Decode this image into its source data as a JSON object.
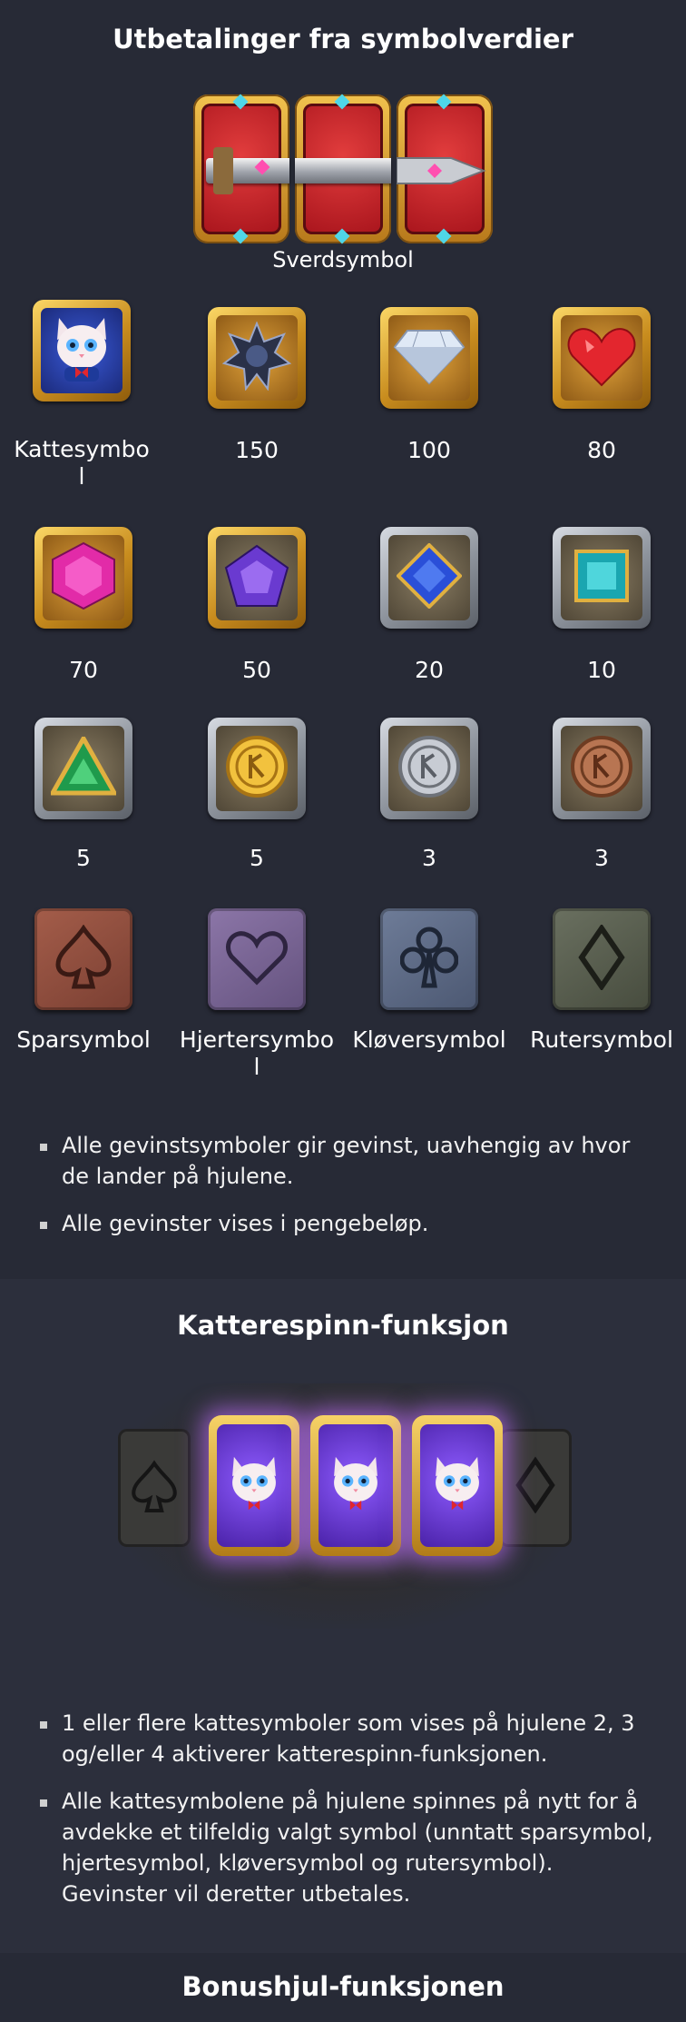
{
  "payouts": {
    "title": "Utbetalinger fra symbolverdier",
    "sword_label": "Sverdsymbol",
    "rows": [
      [
        {
          "icon": "cat-icon",
          "label_line1": "Kattesymbo",
          "label_line2": "l"
        },
        {
          "icon": "black-star-gem-icon",
          "label_line1": "150",
          "label_line2": ""
        },
        {
          "icon": "diamond-icon",
          "label_line1": "100",
          "label_line2": ""
        },
        {
          "icon": "red-heart-gem-icon",
          "label_line1": "80",
          "label_line2": ""
        }
      ],
      [
        {
          "icon": "pink-hexagon-gem-icon",
          "label_line1": "70",
          "label_line2": ""
        },
        {
          "icon": "purple-pentagon-gem-icon",
          "label_line1": "50",
          "label_line2": ""
        },
        {
          "icon": "blue-square-gem-icon",
          "label_line1": "20",
          "label_line2": ""
        },
        {
          "icon": "teal-rectangle-gem-icon",
          "label_line1": "10",
          "label_line2": ""
        }
      ],
      [
        {
          "icon": "green-triangle-gem-icon",
          "label_line1": "5",
          "label_line2": ""
        },
        {
          "icon": "gold-coin-icon",
          "label_line1": "5",
          "label_line2": ""
        },
        {
          "icon": "silver-coin-icon",
          "label_line1": "3",
          "label_line2": ""
        },
        {
          "icon": "bronze-coin-icon",
          "label_line1": "3",
          "label_line2": ""
        }
      ],
      [
        {
          "icon": "spade-icon",
          "label_line1": "Sparsymbol",
          "label_line2": ""
        },
        {
          "icon": "heart-icon",
          "label_line1": "Hjertersymbo",
          "label_line2": "l"
        },
        {
          "icon": "club-icon",
          "label_line1": "Kløversymbol",
          "label_line2": ""
        },
        {
          "icon": "diamond-suit-icon",
          "label_line1": "Rutersymbol",
          "label_line2": ""
        }
      ]
    ],
    "bullets": [
      "Alle gevinstsymboler gir gevinst, uavhengig av hvor de lander på hjulene.",
      "Alle gevinster vises i pengebeløp."
    ],
    "colors": {
      "gold": "#f1c24e",
      "red": "#c8202a",
      "background": "#272a36"
    }
  },
  "cat_spin": {
    "title": "Katterespinn-funksjon",
    "bullets": [
      "1 eller flere kattesymboler som vises på hjulene 2, 3 og/eller 4 aktiverer katterespinn-funksjonen.",
      "Alle kattesymbolene på hjulene spinnes på nytt for å avdekke et tilfeldig valgt symbol (unntatt sparsymbol, hjertesymbol, kløversymbol og rutersymbol). Gevinster vil deretter utbetales."
    ],
    "colors": {
      "glow": "#be6eff",
      "background": "#2c2f3c"
    }
  },
  "bonus": {
    "title": "Bonushjul-funksjonen"
  }
}
